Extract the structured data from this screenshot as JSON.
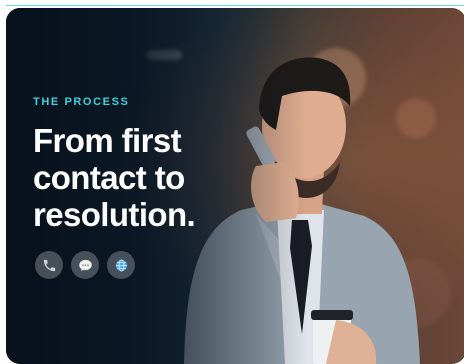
{
  "hero": {
    "eyebrow": "THE PROCESS",
    "headline": "From first contact to resolution."
  },
  "contact_icons": [
    {
      "name": "phone-icon"
    },
    {
      "name": "chat-icon"
    },
    {
      "name": "globe-icon"
    }
  ],
  "colors": {
    "accent": "#3fd2d8",
    "headline": "#ffffff",
    "icon_bg": "#6d747c",
    "card_dark": "#0f1d2b",
    "card_warm": "#6b4738"
  }
}
